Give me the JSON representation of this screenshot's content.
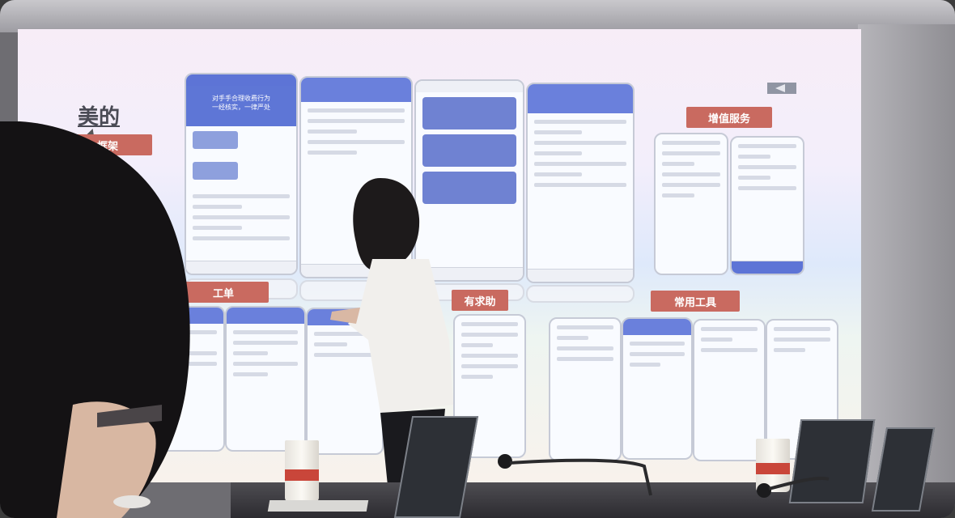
{
  "screen": {
    "title_line1": "美的",
    "title_line2": "框架",
    "tags": {
      "value_added": "增值服务",
      "work_order": "工单",
      "help": "有求助",
      "common_tools": "常用工具"
    },
    "phone_top_text": "对手手合理收费行为",
    "phone_top_text2": "一经核实，一律严处"
  },
  "colors": {
    "tag": "#c96a60",
    "phone_header": "#6a80dc",
    "phone_card": "#6f82d2"
  }
}
